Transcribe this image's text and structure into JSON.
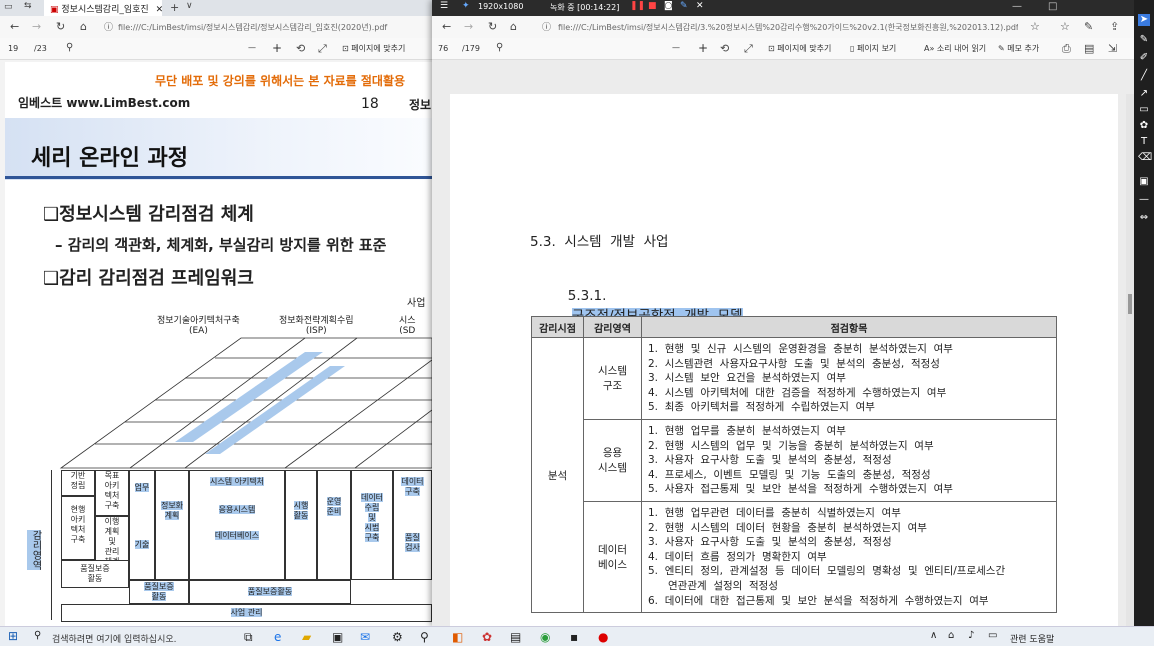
{
  "left_window": {
    "tab_title": "정보시스템감리_임호진",
    "new_tab": "+",
    "address": "file:///C:/LimBest/imsi/정보시스템감리/정보시스템감리_임호진(2020년).pdf",
    "page_current": "19",
    "page_total": "/23",
    "zoom_minus": "—",
    "zoom_plus": "+",
    "fit_page": "페이지에 맞추기",
    "page": {
      "warning": "무단 배포 및 강의를 위해서는 본 자료를 절대활용",
      "brand": "임베스트 www.LimBest.com",
      "page_no": "18",
      "header_right": "정보",
      "banner": "세리 온라인 과정",
      "heading1": "❑정보시스템 감리점검 체계",
      "sub1": "– 감리의 객관화, 체계화, 부실감리 방지를 위한  표준",
      "heading2": "❑감리 감리점검 프레임워크",
      "diagram": {
        "top_right": "사업",
        "col_ea": "정보기술아키텍처구축\n(EA)",
        "col_isp": "정보화전략계획수립\n(ISP)",
        "col_sd": "시스\n(SD",
        "left_label": "감리영역",
        "rows": [
          {
            "a": "기반\n정립",
            "b": "목표\n아키\n텍처\n구축"
          },
          {
            "a": "현행\n아키\n텍처\n구축",
            "b": "이행\n계획\n및\n관리\n체계"
          }
        ],
        "analysis": "업무",
        "process": "정보화\n계획",
        "tech": "기술",
        "arch": "시스템 아키텍처",
        "app": "응용시스템",
        "db": "데이터베이스",
        "exec": "시행\n활동",
        "ops": "운영\n준비",
        "data": "데이터\n수립\n및\n시범\n구축",
        "data2": "데이터\n구축",
        "quality_left": "품질보증\n활동",
        "quality_mid": "품질보증\n활동",
        "quality_wide": "품질보증활동",
        "mgmt": "사업 관리",
        "eval": "품질\n검사"
      }
    }
  },
  "recorder": {
    "resolution": "1920x1080",
    "status": "녹화 중 [00:14:22]"
  },
  "right_window": {
    "address": "file:///C:/LimBest/imsi/정보시스템감리/3.%20정보시스템%20감리수행%20가이드%20v2.1(한국정보화진흥원,%202013.12).pdf",
    "page_current": "76",
    "page_total": "/179",
    "zoom_minus": "—",
    "zoom_plus": "+",
    "fit_page": "페이지에 맞추기",
    "page_view": "페이지 보기",
    "read_aloud": "소리 내어 읽기",
    "add_note": "메모 추가",
    "doc": {
      "section": "5.3.  시스템  개발  사업",
      "subsection_no": "5.3.1.",
      "subsection_title": "구조적/정보공학적  개발  모델",
      "table": {
        "headers": [
          "감리시점",
          "감리영역",
          "점검항목"
        ],
        "phase": "분석",
        "rows": [
          {
            "area": "시스템\n구조",
            "items": [
              "1.  현행  및  신규  시스템의  운영환경을  충분히  분석하였는지  여부",
              "2.  시스템관련  사용자요구사항  도출  및  분석의  충분성,  적정성",
              "3.  시스템  보안  요건을  분석하였는지  여부",
              "4.  시스템  아키텍처에  대한  검증을  적정하게  수행하였는지  여부",
              "5.  최종  아키텍처를  적정하게  수립하였는지  여부"
            ]
          },
          {
            "area": "응용\n시스템",
            "items": [
              "1.  현행  업무를  충분히  분석하였는지  여부",
              "2.  현행  시스템의  업무  및  기능을  충분히  분석하였는지  여부",
              "3.  사용자  요구사항  도출  및  분석의  충분성,  적정성",
              "4.  프로세스,  이벤트  모델링  및  기능  도출의  충분성,  적정성",
              "5.  사용자  접근통제  및  보안  분석을  적정하게  수행하였는지  여부"
            ]
          },
          {
            "area": "데이터\n베이스",
            "items": [
              "1.  현행  업무관련  데이터를  충분히  식별하였는지  여부",
              "2.  현행  시스템의  데이터  현황을  충분히  분석하였는지  여부",
              "3.  사용자  요구사항  도출  및  분석의  충분성,  적정성",
              "4.  데이터  흐름  정의가  명확한지  여부",
              "5.  엔티티  정의,  관계설정  등  데이터  모델링의  명확성  및  엔티티/프로세스간\n      연관관계  설정의  적정성",
              "6.  데이터에  대한  접근통제  및  보안  분석을  적정하게  수행하였는지  여부"
            ]
          }
        ]
      }
    }
  },
  "taskbar": {
    "search_placeholder": "검색하려면 여기에 입력하십시오.",
    "tray_text": "관련 도움말"
  }
}
